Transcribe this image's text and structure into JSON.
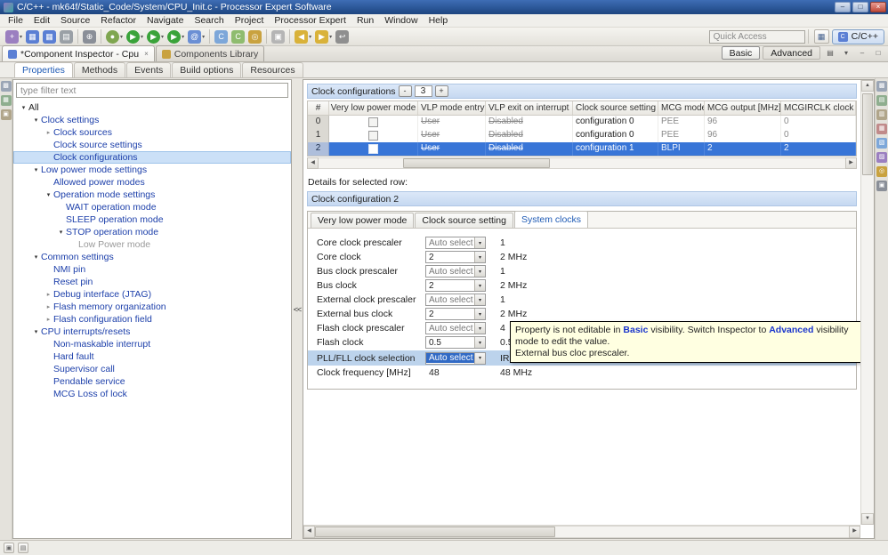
{
  "window": {
    "title": "C/C++ - mk64f/Static_Code/System/CPU_Init.c - Processor Expert Software",
    "controls": {
      "minimize": "–",
      "maximize": "□",
      "close": "×"
    }
  },
  "menu": {
    "items": [
      "File",
      "Edit",
      "Source",
      "Refactor",
      "Navigate",
      "Search",
      "Project",
      "Processor Expert",
      "Run",
      "Window",
      "Help"
    ]
  },
  "toolbar": {
    "quick_access": {
      "placeholder": "Quick Access"
    },
    "perspective": {
      "label": "C/C++",
      "icon_glyph": "C"
    },
    "open_perspective_glyph": "▦",
    "groups": [
      {
        "items": [
          {
            "name": "new-wizard-button",
            "glyph": "+",
            "color": "#9b7fc0",
            "dropdown": true
          },
          {
            "name": "save-button",
            "glyph": "▦",
            "color": "#5b7fd4"
          },
          {
            "name": "save-all-button",
            "glyph": "▦",
            "color": "#5b7fd4"
          },
          {
            "name": "print-button",
            "glyph": "▤",
            "color": "#9aa0a6"
          }
        ]
      },
      {
        "items": [
          {
            "name": "build-button",
            "glyph": "⊕",
            "color": "#8a8f98"
          }
        ]
      },
      {
        "items": [
          {
            "name": "debug-button",
            "glyph": "●",
            "color": "#7fa650",
            "dropdown": true,
            "shape": "circle"
          },
          {
            "name": "run-button",
            "glyph": "▶",
            "color": "#3aa33a",
            "dropdown": true,
            "shape": "circle"
          },
          {
            "name": "profile-button",
            "glyph": "▶",
            "color": "#3aa33a",
            "dropdown": true,
            "shape": "circle"
          },
          {
            "name": "external-tools-button",
            "glyph": "▶",
            "color": "#3aa33a",
            "dropdown": true,
            "shape": "circle"
          },
          {
            "name": "console-button",
            "glyph": "@",
            "color": "#6b8fd4",
            "dropdown": true
          }
        ]
      },
      {
        "items": [
          {
            "name": "new-c-file-button",
            "glyph": "C",
            "color": "#7da7d9"
          },
          {
            "name": "new-class-button",
            "glyph": "C",
            "color": "#8fbc6f"
          },
          {
            "name": "search-button",
            "glyph": "◎",
            "color": "#c9a23f"
          }
        ]
      },
      {
        "items": [
          {
            "name": "mark-occurrences-toggle",
            "glyph": "▣",
            "color": "#b5b5b5"
          }
        ]
      },
      {
        "items": [
          {
            "name": "back-button",
            "glyph": "◀",
            "color": "#d9b23a",
            "dropdown": true
          },
          {
            "name": "forward-button",
            "glyph": "▶",
            "color": "#d9b23a",
            "dropdown": true
          },
          {
            "name": "last-edit-location-button",
            "glyph": "↩",
            "color": "#8f8f8f"
          }
        ]
      }
    ]
  },
  "tabs": {
    "editor": [
      {
        "label": "*Component Inspector - Cpu",
        "active": true,
        "icon_color": "#5b7fd4"
      },
      {
        "label": "Components Library",
        "active": false,
        "icon_color": "#c9a23f"
      }
    ],
    "visibility": [
      {
        "label": "Basic",
        "active": true
      },
      {
        "label": "Advanced",
        "active": false
      }
    ],
    "view_controls": [
      {
        "name": "filter-layout-icon",
        "glyph": "▤"
      },
      {
        "name": "view-menu-icon",
        "glyph": "▾"
      },
      {
        "name": "minimize-view-icon",
        "glyph": "–"
      },
      {
        "name": "maximize-view-icon",
        "glyph": "□"
      }
    ],
    "inspector": [
      {
        "label": "Properties",
        "active": true
      },
      {
        "label": "Methods",
        "active": false
      },
      {
        "label": "Events",
        "active": false
      },
      {
        "label": "Build options",
        "active": false
      },
      {
        "label": "Resources",
        "active": false
      }
    ]
  },
  "left_strip": {
    "icons": [
      {
        "name": "restore-left-panel-icon",
        "glyph": "▩",
        "color": "#9aa5b5"
      },
      {
        "name": "open-view-icon",
        "glyph": "▦",
        "color": "#8fae8f"
      },
      {
        "name": "expand-all-icon",
        "glyph": "▣",
        "color": "#b0a58a"
      }
    ]
  },
  "right_strip": {
    "icons": [
      {
        "name": "restore-right-panel-icon",
        "glyph": "▩",
        "color": "#9aa5b5"
      },
      {
        "name": "outline-view-icon",
        "glyph": "▤",
        "color": "#8fae8f"
      },
      {
        "name": "build-view-icon",
        "glyph": "▥",
        "color": "#b0a58a"
      },
      {
        "name": "problems-view-icon",
        "glyph": "▦",
        "color": "#c08a8a"
      },
      {
        "name": "console-view-icon",
        "glyph": "▧",
        "color": "#7da7d9"
      },
      {
        "name": "tasks-view-icon",
        "glyph": "▨",
        "color": "#9b7fc0"
      },
      {
        "name": "search-view-icon",
        "glyph": "◎",
        "color": "#c9a23f"
      },
      {
        "name": "progress-view-icon",
        "glyph": "▣",
        "color": "#8a8f98"
      }
    ]
  },
  "tree": {
    "filter_placeholder": "type filter text",
    "items": [
      {
        "label": "All",
        "level": 0,
        "arrow": "expanded",
        "color": "#222222"
      },
      {
        "label": "Clock settings",
        "level": 1,
        "arrow": "expanded"
      },
      {
        "label": "Clock sources",
        "level": 2,
        "arrow": "collapsed"
      },
      {
        "label": "Clock source settings",
        "level": 2,
        "arrow": "none"
      },
      {
        "label": "Clock configurations",
        "level": 2,
        "arrow": "none",
        "selected": true
      },
      {
        "label": "Low power mode settings",
        "level": 1,
        "arrow": "expanded"
      },
      {
        "label": "Allowed power modes",
        "level": 2,
        "arrow": "none"
      },
      {
        "label": "Operation mode settings",
        "level": 2,
        "arrow": "expanded"
      },
      {
        "label": "WAIT operation mode",
        "level": 3,
        "arrow": "none"
      },
      {
        "label": "SLEEP operation mode",
        "level": 3,
        "arrow": "none"
      },
      {
        "label": "STOP operation mode",
        "level": 3,
        "arrow": "expanded"
      },
      {
        "label": "Low Power mode",
        "level": 4,
        "arrow": "none",
        "muted": true
      },
      {
        "label": "Common settings",
        "level": 1,
        "arrow": "expanded"
      },
      {
        "label": "NMI pin",
        "level": 2,
        "arrow": "none"
      },
      {
        "label": "Reset pin",
        "level": 2,
        "arrow": "none"
      },
      {
        "label": "Debug interface (JTAG)",
        "level": 2,
        "arrow": "collapsed"
      },
      {
        "label": "Flash memory organization",
        "level": 2,
        "arrow": "collapsed"
      },
      {
        "label": "Flash configuration field",
        "level": 2,
        "arrow": "collapsed"
      },
      {
        "label": "CPU interrupts/resets",
        "level": 1,
        "arrow": "expanded"
      },
      {
        "label": "Non-maskable interrupt",
        "level": 2,
        "arrow": "none"
      },
      {
        "label": "Hard fault",
        "level": 2,
        "arrow": "none"
      },
      {
        "label": "Supervisor call",
        "level": 2,
        "arrow": "none"
      },
      {
        "label": "Pendable service",
        "level": 2,
        "arrow": "none"
      },
      {
        "label": "MCG Loss of lock",
        "level": 2,
        "arrow": "none"
      }
    ]
  },
  "splitter": {
    "collapse_label": "<<"
  },
  "config_table": {
    "header_title": "Clock configurations",
    "minus_label": "-",
    "count": "3",
    "plus_label": "+",
    "columns": [
      "#",
      "Very low power mode",
      "VLP mode entry",
      "VLP exit on interrupt",
      "Clock source setting",
      "MCG mode",
      "MCG output [MHz]",
      "MCGIRCLK clock [MHz]"
    ],
    "rows": [
      {
        "num": "0",
        "vlp_checked": false,
        "vlp_entry": "User",
        "vlp_exit": "Disabled",
        "clock_source": "configuration 0",
        "mcg_mode": "PEE",
        "mcg_output": "96",
        "mcgirclk": "0",
        "selected": false
      },
      {
        "num": "1",
        "vlp_checked": false,
        "vlp_entry": "User",
        "vlp_exit": "Disabled",
        "clock_source": "configuration 0",
        "mcg_mode": "PEE",
        "mcg_output": "96",
        "mcgirclk": "0",
        "selected": false
      },
      {
        "num": "2",
        "vlp_checked": false,
        "vlp_entry": "User",
        "vlp_exit": "Disabled",
        "clock_source": "configuration 1",
        "mcg_mode": "BLPI",
        "mcg_output": "2",
        "mcgirclk": "2",
        "selected": true
      }
    ]
  },
  "details": {
    "caption": "Details for selected row:",
    "title": "Clock configuration 2",
    "tabs": [
      {
        "label": "Very low power mode",
        "active": false
      },
      {
        "label": "Clock source setting",
        "active": false
      },
      {
        "label": "System clocks",
        "active": true
      }
    ],
    "fields": [
      {
        "label": "Core clock prescaler",
        "control": "combo",
        "value": "Auto select",
        "muted": true,
        "result": "1"
      },
      {
        "label": "Core clock",
        "control": "combo",
        "value": "2",
        "result": "2 MHz"
      },
      {
        "label": "Bus clock prescaler",
        "control": "combo",
        "value": "Auto select",
        "muted": true,
        "result": "1"
      },
      {
        "label": "Bus clock",
        "control": "combo",
        "value": "2",
        "result": "2 MHz"
      },
      {
        "label": "External clock prescaler",
        "control": "combo",
        "value": "Auto select",
        "muted": true,
        "result": "1"
      },
      {
        "label": "External bus clock",
        "control": "combo",
        "value": "2",
        "result": "2 MHz"
      },
      {
        "label": "Flash clock prescaler",
        "control": "combo",
        "value": "Auto select",
        "muted": true,
        "result": "4"
      },
      {
        "label": "Flash clock",
        "control": "combo",
        "value": "0.5",
        "result": "0.5 MHz"
      },
      {
        "label": "PLL/FLL clock selection",
        "control": "combo",
        "value": "Auto select",
        "selected": true,
        "row_highlight": true,
        "result": "IRC 48MHz clock"
      },
      {
        "label": "Clock frequency [MHz]",
        "control": "text",
        "value": "48",
        "result": "48 MHz"
      }
    ]
  },
  "tooltip": {
    "line1": [
      {
        "text": "Property is not editable in "
      },
      {
        "text": "Basic",
        "style": "link"
      },
      {
        "text": " visibility. Switch Inspector to "
      },
      {
        "text": "Advanced",
        "style": "link"
      },
      {
        "text": " visibility mode to edit the value."
      }
    ],
    "line2": "External bus cloc prescaler."
  },
  "icons": {
    "up": "▲",
    "down": "▼",
    "left": "◀",
    "right": "▶"
  },
  "status": {
    "icons": [
      {
        "name": "fast-view-icon",
        "glyph": "▣"
      },
      {
        "name": "trim-handle-icon",
        "glyph": "▤"
      }
    ]
  }
}
